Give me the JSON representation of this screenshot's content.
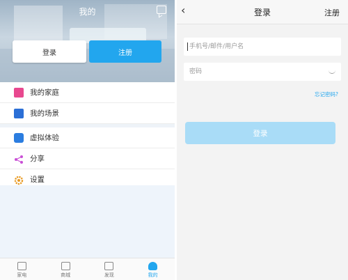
{
  "left": {
    "header_title": "我的",
    "login_label": "登录",
    "register_label": "注册",
    "menu_group1": [
      {
        "label": "我的家庭",
        "icon": "home-icon",
        "color": "#e8488f"
      },
      {
        "label": "我的场景",
        "icon": "clapper-icon",
        "color": "#2b6fd6"
      }
    ],
    "menu_group2": [
      {
        "label": "虚拟体验",
        "icon": "touch-icon",
        "color": "#2b7de0"
      },
      {
        "label": "分享",
        "icon": "share-icon",
        "color": "#c94fd6"
      },
      {
        "label": "设置",
        "icon": "gear-icon",
        "color": "#e89a22"
      }
    ],
    "tabs": [
      {
        "label": "家电",
        "icon": "grid-icon"
      },
      {
        "label": "商城",
        "icon": "store-icon"
      },
      {
        "label": "发现",
        "icon": "discover-icon"
      },
      {
        "label": "我的",
        "icon": "user-icon",
        "active": true
      }
    ]
  },
  "right": {
    "title": "登录",
    "register_link": "注册",
    "account_placeholder": "手机号/邮件/用户名",
    "password_placeholder": "密码",
    "forgot_label": "忘记密码?",
    "submit_label": "登录"
  },
  "colors": {
    "accent": "#22a6ee",
    "submit_disabled": "#a9dcf7"
  }
}
